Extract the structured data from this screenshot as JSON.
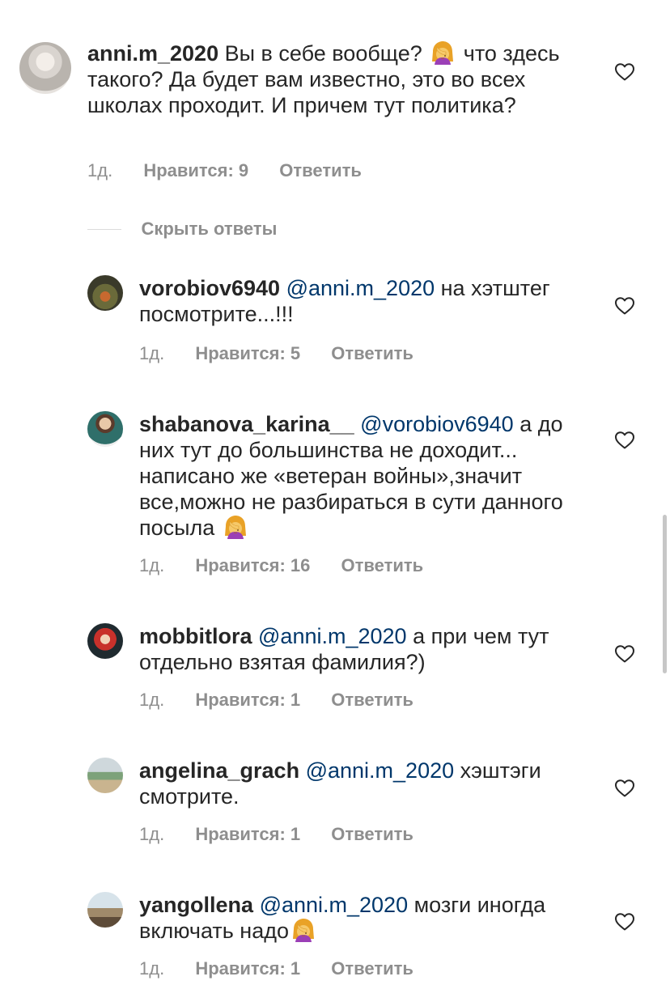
{
  "main_comment": {
    "username": "anni.m_2020",
    "text_1": "Вы в себе вообще?",
    "text_2": "что здесь такого? Да будет вам известно, это во всех школах проходит. И причем тут политика?",
    "emoji_icon": "woman-facepalming-icon",
    "time": "1д.",
    "likes": "Нравится: 9",
    "reply": "Ответить"
  },
  "hide_replies_label": "Скрыть ответы",
  "replies": [
    {
      "username": "vorobiov6940",
      "mention": "@anni.m_2020",
      "text": "на хэтштег посмотрите...!!!",
      "time": "1д.",
      "likes": "Нравится: 5",
      "reply": "Ответить"
    },
    {
      "username": "shabanova_karina__",
      "mention": "@vorobiov6940",
      "text": "а до них тут до большинства не доходит... написано же «ветеран войны»,значит все,можно не разбираться в сути данного посыла",
      "emoji_icon": "woman-facepalming-icon",
      "time": "1д.",
      "likes": "Нравится: 16",
      "reply": "Ответить"
    },
    {
      "username": "mobbitlora",
      "mention": "@anni.m_2020",
      "text": "а при чем тут отдельно взятая фамилия?)",
      "time": "1д.",
      "likes": "Нравится: 1",
      "reply": "Ответить"
    },
    {
      "username": "angelina_grach",
      "mention": "@anni.m_2020",
      "text": "хэштэги смотрите.",
      "time": "1д.",
      "likes": "Нравится: 1",
      "reply": "Ответить"
    },
    {
      "username": "yangollena",
      "mention": "@anni.m_2020",
      "text": "мозги иногда включать надо",
      "emoji_icon": "woman-facepalming-icon",
      "time": "1д.",
      "likes": "Нравится: 1",
      "reply": "Ответить"
    }
  ],
  "colors": {
    "text": "#262626",
    "secondary": "#8e8e8e",
    "mention": "#00376b",
    "background": "#ffffff"
  }
}
